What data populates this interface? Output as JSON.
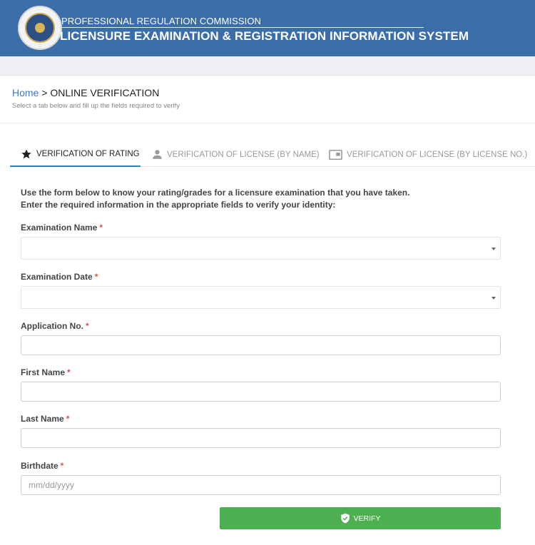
{
  "header": {
    "org_name": "PROFESSIONAL REGULATION COMMISSION",
    "system_name": "LICENSURE EXAMINATION & REGISTRATION INFORMATION SYSTEM",
    "color": "#3b6ea8"
  },
  "breadcrumb": {
    "home": "Home",
    "separator": " > ",
    "current": "ONLINE VERIFICATION",
    "subtitle": "Select a tab below and fill up the fields required to verify"
  },
  "tabs": [
    {
      "label": "VERIFICATION OF RATING",
      "icon": "star-icon",
      "active": true
    },
    {
      "label": "VERIFICATION OF LICENSE (BY NAME)",
      "icon": "user-icon",
      "active": false
    },
    {
      "label": "VERIFICATION OF LICENSE (BY LICENSE NO.)",
      "icon": "id-card-icon",
      "active": false
    }
  ],
  "intro": {
    "line1": "Use the form below to know your rating/grades for a licensure examination that you have taken.",
    "line2": "Enter the required information in the appropriate fields to verify your identity:"
  },
  "form": {
    "required_mark": "*",
    "exam_name_label": "Examination Name",
    "exam_name_value": "",
    "exam_date_label": "Examination Date",
    "exam_date_value": "",
    "application_no_label": "Application No.",
    "application_no_value": "",
    "first_name_label": "First Name",
    "first_name_value": "",
    "last_name_label": "Last Name",
    "last_name_value": "",
    "birthdate_label": "Birthdate",
    "birthdate_placeholder": "mm/dd/yyyy",
    "verify_label": "VERIFY"
  },
  "colors": {
    "accent": "#2e7ec9",
    "verify_button": "#4caf50",
    "required": "#d9534f"
  }
}
